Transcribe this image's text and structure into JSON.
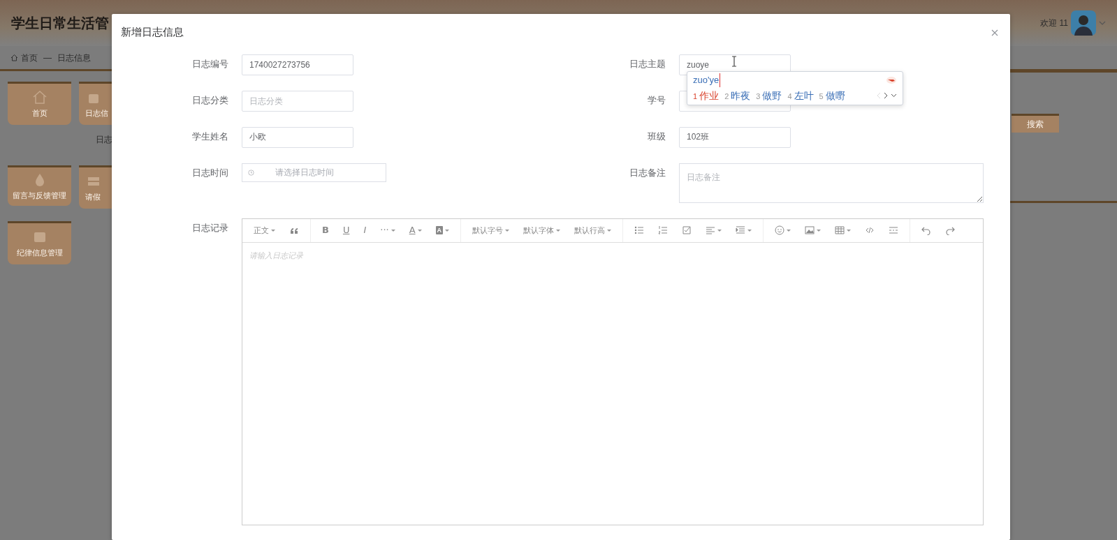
{
  "background_page": {
    "title": "学生日常生活管",
    "greeting": "欢迎 11",
    "breadcrumb": {
      "items": [
        "首页",
        "日志信息"
      ],
      "separator": "—"
    },
    "tiles": [
      {
        "label": "首页"
      },
      {
        "label": "日志信"
      },
      {
        "label": "留言与反馈管理"
      },
      {
        "label": "请假"
      },
      {
        "label": "纪律信息管理"
      }
    ],
    "sub_tab": "日志",
    "search_button": "搜索"
  },
  "dialog": {
    "title": "新增日志信息",
    "fields": [
      {
        "kind": "text",
        "label": "日志编号",
        "value": "1740027273756"
      },
      {
        "kind": "text",
        "label": "日志主题",
        "value": "zuoye"
      },
      {
        "kind": "text",
        "label": "日志分类",
        "placeholder": "日志分类"
      },
      {
        "kind": "text",
        "label": "学号"
      },
      {
        "kind": "text",
        "label": "学生姓名",
        "value": "小欧"
      },
      {
        "kind": "text",
        "label": "班级",
        "value": "102班"
      },
      {
        "kind": "date",
        "label": "日志时间",
        "placeholder": "请选择日志时间"
      },
      {
        "kind": "textarea",
        "label": "日志备注",
        "placeholder": "日志备注"
      },
      {
        "kind": "editor",
        "label": "日志记录",
        "placeholder": "请输入日志记录"
      }
    ],
    "toolbar": [
      [
        {
          "kind": "select",
          "label": "正文"
        },
        {
          "kind": "icon",
          "caret": false
        }
      ],
      [
        {
          "kind": "bold",
          "label": "B",
          "caret": false
        },
        {
          "kind": "underline",
          "label": "U",
          "caret": false
        },
        {
          "kind": "italic",
          "label": "I",
          "caret": false
        },
        {
          "kind": "glyph",
          "label": "···",
          "caret": true
        },
        {
          "kind": "underline",
          "label": "A",
          "caret": true
        },
        {
          "kind": "boxed",
          "label": "A",
          "caret": true
        }
      ],
      [
        {
          "kind": "select",
          "label": "默认字号"
        },
        {
          "kind": "select",
          "label": "默认字体"
        },
        {
          "kind": "select",
          "label": "默认行高"
        }
      ],
      [
        {
          "kind": "icon",
          "caret": false
        },
        {
          "kind": "icon",
          "caret": false
        },
        {
          "kind": "icon",
          "caret": false
        },
        {
          "kind": "icon",
          "caret": true
        },
        {
          "kind": "icon",
          "caret": true
        }
      ],
      [
        {
          "kind": "icon",
          "caret": true
        },
        {
          "kind": "icon",
          "caret": true
        },
        {
          "kind": "icon",
          "caret": true
        },
        {
          "kind": "icon",
          "caret": false
        },
        {
          "kind": "icon",
          "caret": false
        }
      ],
      [
        {
          "kind": "icon",
          "caret": false
        },
        {
          "kind": "icon",
          "caret": false
        }
      ]
    ]
  },
  "ime": {
    "composition": "zuo'ye",
    "candidates": [
      {
        "index": "1",
        "text": "作业",
        "selected": true
      },
      {
        "index": "2",
        "text": "昨夜",
        "selected": false
      },
      {
        "index": "3",
        "text": "做野",
        "selected": false
      },
      {
        "index": "4",
        "text": "左叶",
        "selected": false
      },
      {
        "index": "5",
        "text": "做嘢",
        "selected": false
      }
    ]
  }
}
